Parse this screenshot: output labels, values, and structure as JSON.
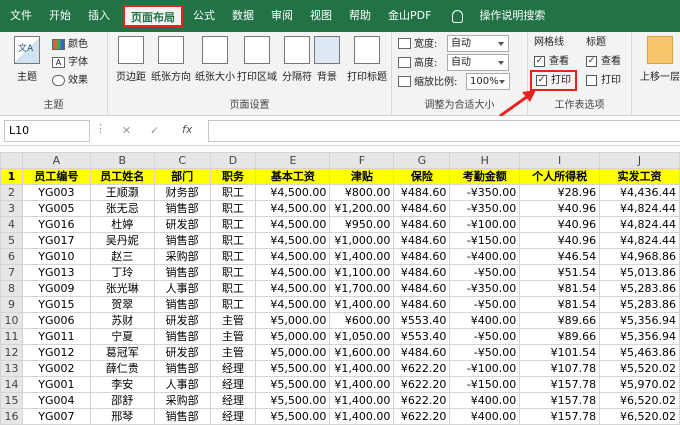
{
  "tabs": [
    "文件",
    "开始",
    "插入",
    "页面布局",
    "公式",
    "数据",
    "审阅",
    "视图",
    "帮助",
    "金山PDF",
    "操作说明搜索"
  ],
  "active_tab": "页面布局",
  "ribbon": {
    "theme": {
      "main": "主题",
      "colors": "颜色",
      "fonts": "字体",
      "effects": "效果",
      "group": "主题"
    },
    "page_setup": {
      "margins": "页边距",
      "orientation": "纸张方向",
      "size": "纸张大小",
      "print_area": "打印区域",
      "breaks": "分隔符",
      "background": "背景",
      "print_titles": "打印标题",
      "group": "页面设置"
    },
    "scale": {
      "width_label": "宽度:",
      "width_value": "自动",
      "height_label": "高度:",
      "height_value": "自动",
      "scale_label": "缩放比例:",
      "scale_value": "100%",
      "group": "调整为合适大小"
    },
    "sheet_options": {
      "gridlines": "网格线",
      "headings": "标题",
      "view": "查看",
      "print": "打印",
      "view2": "查看",
      "print2": "打印",
      "group": "工作表选项"
    },
    "arrange": {
      "bring_forward": "上移一层"
    }
  },
  "formula_bar": {
    "name_box": "L10",
    "fx": "fx",
    "cancel": "✕",
    "enter": "✓"
  },
  "columns": [
    "A",
    "B",
    "C",
    "D",
    "E",
    "F",
    "G",
    "H",
    "I",
    "J"
  ],
  "header_row": [
    "员工编号",
    "员工姓名",
    "部门",
    "职务",
    "基本工资",
    "津贴",
    "保险",
    "考勤金额",
    "个人所得税",
    "实发工资"
  ],
  "rows": [
    [
      "YG003",
      "王顺灏",
      "财务部",
      "职工",
      "¥4,500.00",
      "¥800.00",
      "¥484.60",
      "-¥350.00",
      "¥28.96",
      "¥4,436.44"
    ],
    [
      "YG005",
      "张无忌",
      "销售部",
      "职工",
      "¥4,500.00",
      "¥1,200.00",
      "¥484.60",
      "-¥350.00",
      "¥40.96",
      "¥4,824.44"
    ],
    [
      "YG016",
      "杜婷",
      "研发部",
      "职工",
      "¥4,500.00",
      "¥950.00",
      "¥484.60",
      "-¥100.00",
      "¥40.96",
      "¥4,824.44"
    ],
    [
      "YG017",
      "吴丹妮",
      "销售部",
      "职工",
      "¥4,500.00",
      "¥1,000.00",
      "¥484.60",
      "-¥150.00",
      "¥40.96",
      "¥4,824.44"
    ],
    [
      "YG010",
      "赵三",
      "采购部",
      "职工",
      "¥4,500.00",
      "¥1,400.00",
      "¥484.60",
      "-¥400.00",
      "¥46.54",
      "¥4,968.86"
    ],
    [
      "YG013",
      "丁玲",
      "销售部",
      "职工",
      "¥4,500.00",
      "¥1,100.00",
      "¥484.60",
      "-¥50.00",
      "¥51.54",
      "¥5,013.86"
    ],
    [
      "YG009",
      "张光琳",
      "人事部",
      "职工",
      "¥4,500.00",
      "¥1,700.00",
      "¥484.60",
      "-¥350.00",
      "¥81.54",
      "¥5,283.86"
    ],
    [
      "YG015",
      "贺翠",
      "销售部",
      "职工",
      "¥4,500.00",
      "¥1,400.00",
      "¥484.60",
      "-¥50.00",
      "¥81.54",
      "¥5,283.86"
    ],
    [
      "YG006",
      "苏财",
      "研发部",
      "主管",
      "¥5,000.00",
      "¥600.00",
      "¥553.40",
      "¥400.00",
      "¥89.66",
      "¥5,356.94"
    ],
    [
      "YG011",
      "宁夏",
      "销售部",
      "主管",
      "¥5,000.00",
      "¥1,050.00",
      "¥553.40",
      "-¥50.00",
      "¥89.66",
      "¥5,356.94"
    ],
    [
      "YG012",
      "葛冠军",
      "研发部",
      "主管",
      "¥5,000.00",
      "¥1,600.00",
      "¥484.60",
      "-¥50.00",
      "¥101.54",
      "¥5,463.86"
    ],
    [
      "YG002",
      "薛仁贵",
      "销售部",
      "经理",
      "¥5,500.00",
      "¥1,400.00",
      "¥622.20",
      "-¥100.00",
      "¥107.78",
      "¥5,520.02"
    ],
    [
      "YG001",
      "李安",
      "人事部",
      "经理",
      "¥5,500.00",
      "¥1,400.00",
      "¥622.20",
      "-¥150.00",
      "¥157.78",
      "¥5,970.02"
    ],
    [
      "YG004",
      "邵舒",
      "采购部",
      "经理",
      "¥5,500.00",
      "¥1,400.00",
      "¥622.20",
      "¥400.00",
      "¥157.78",
      "¥6,520.02"
    ],
    [
      "YG007",
      "邢琴",
      "销售部",
      "经理",
      "¥5,500.00",
      "¥1,400.00",
      "¥622.20",
      "¥400.00",
      "¥157.78",
      "¥6,520.02"
    ]
  ],
  "colors": {
    "ribbon_green": "#217346",
    "header_fill": "#ffff00",
    "highlight": "#e8231f"
  }
}
